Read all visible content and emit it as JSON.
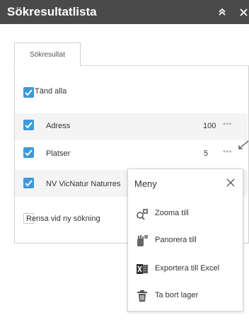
{
  "window": {
    "title": "Sökresultatlista",
    "icons": [
      "collapse-up-icon",
      "close-icon"
    ]
  },
  "tabs": [
    {
      "label": "Sökresultat"
    }
  ],
  "toggle_all": {
    "label": "Tänd alla",
    "checked": true
  },
  "layers": [
    {
      "label": "Adress",
      "count": "100",
      "checked": true
    },
    {
      "label": "Platser",
      "count": "5",
      "checked": true
    },
    {
      "label": "NV VicNatur Naturres",
      "count": "",
      "checked": true
    }
  ],
  "clear_on_search": {
    "label": "Rensa vid ny sökning",
    "checked": false
  },
  "menu": {
    "title": "Meny",
    "items": [
      {
        "label": "Zooma till",
        "icon": "zoom-to-icon"
      },
      {
        "label": "Panorera till",
        "icon": "pan-to-icon"
      },
      {
        "label": "Exportera till Excel",
        "icon": "excel-icon"
      },
      {
        "label": "Ta bort lager",
        "icon": "trash-icon"
      }
    ]
  },
  "colors": {
    "titlebar": "#4a4a4a",
    "checkbox": "#3c99dc"
  }
}
